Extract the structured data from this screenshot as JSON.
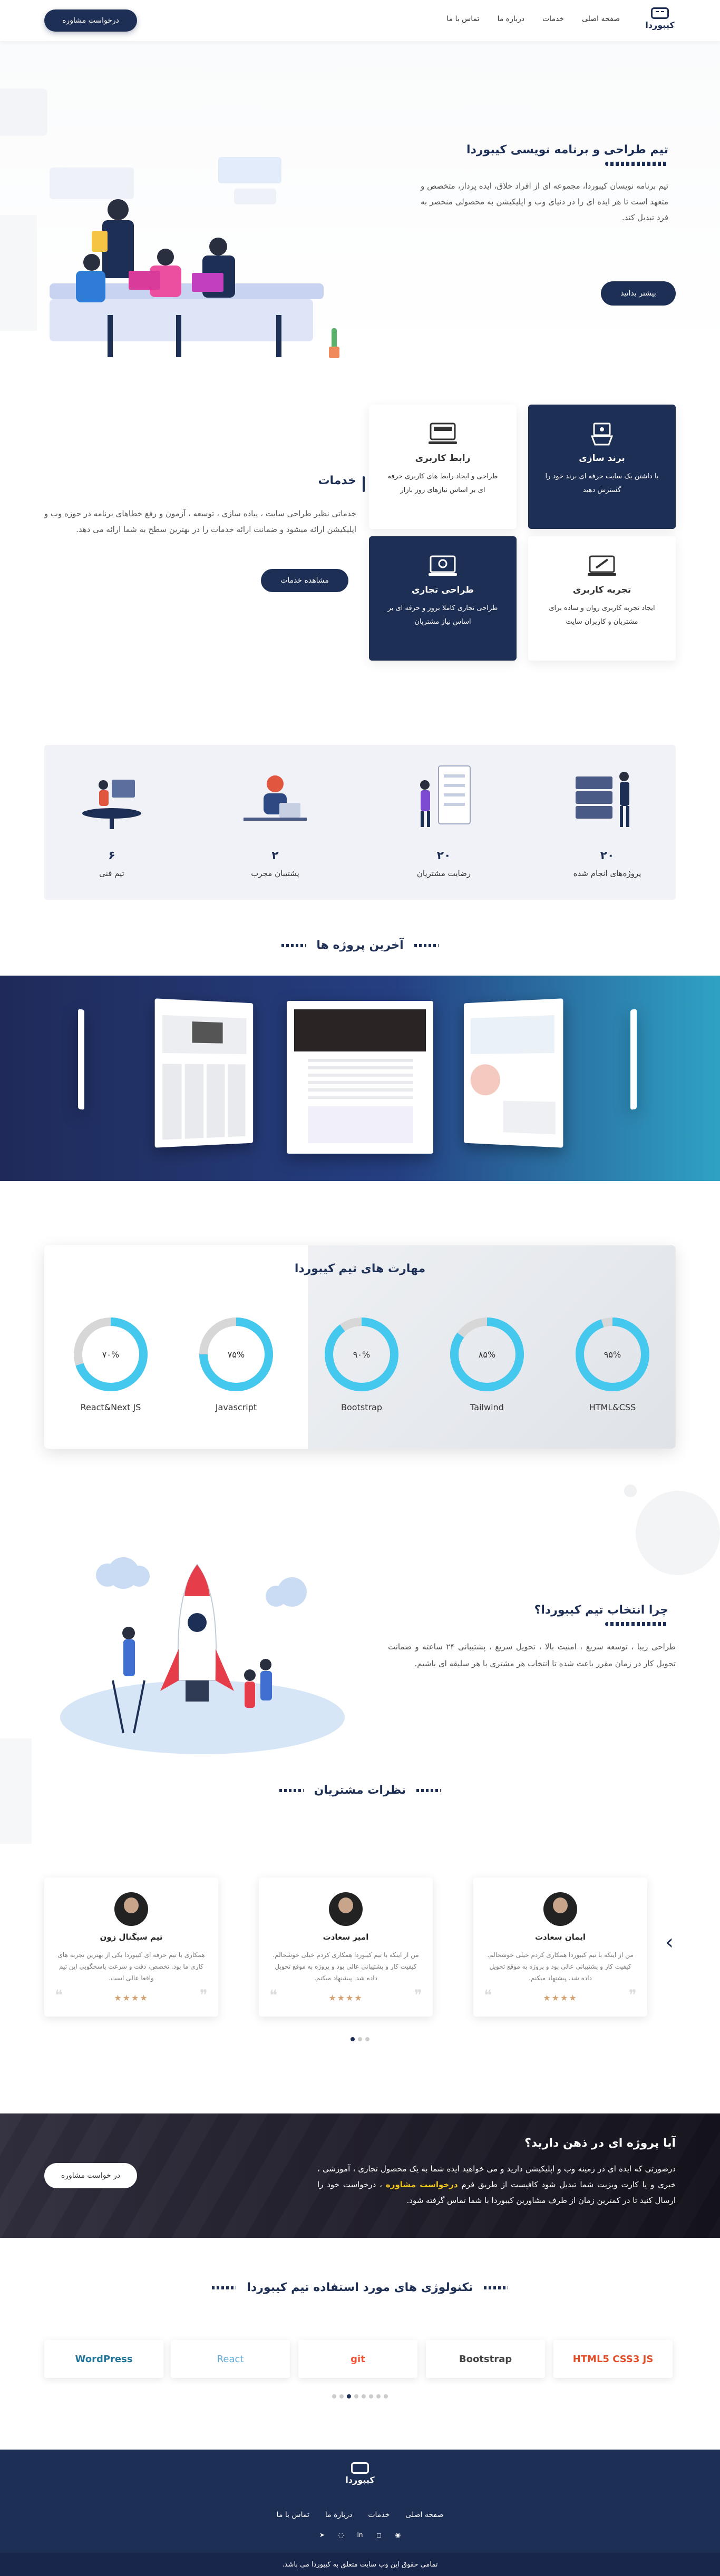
{
  "header": {
    "logo_text": "کیبوردا",
    "nav": [
      "صفحه اصلی",
      "خدمات",
      "درباره ما",
      "تماس با ما"
    ],
    "cta": "درخواست مشاوره"
  },
  "hero": {
    "title": "تیم طراحی و برنامه نویسی کیبوردا",
    "text": "تیم برنامه نویسان کیبوردا، مجموعه ای از افراد خلاق، ایده پرداز، متخصص و متعهد است تا هر ایده ای را در دنیای وب و اپلیکیشن به محصولی منحصر به فرد تبدیل کند.",
    "button": "بیشتر بدانید"
  },
  "services": {
    "title": "خدمات",
    "text": "خدماتی نظیر طراحی سایت ، پیاده سازی ، توسعه ، آزمون و رفع خطاهای برنامه در حوزه وب و اپلیکیشن ارائه میشود و ضمانت ارائه خدمات را در بهترین سطح به شما ارائه می دهد.",
    "button": "مشاهده خدمات",
    "cards": [
      {
        "title": "برند سازی",
        "text": "با داشتن یک سایت حرفه ای برند خود را گسترش دهید",
        "icon": "branding-icon"
      },
      {
        "title": "رابط کاربری",
        "text": "طراحی و ایجاد رابط های کاربری حرفه ای بر اساس نیازهای روز بازار",
        "icon": "ui-icon"
      },
      {
        "title": "تجربه کاربری",
        "text": "ایجاد تجربه کاربری روان و ساده برای مشتریان و کاربران سایت",
        "icon": "ux-icon"
      },
      {
        "title": "طراحی تجاری",
        "text": "طراحی تجاری کاملا بروز و حرفه ای بر اساس نیاز مشتریان",
        "icon": "commercial-design-icon"
      }
    ]
  },
  "stats": [
    {
      "num": "۲۰",
      "label": "پروژه‌های انجام شده"
    },
    {
      "num": "۲۰",
      "label": "رضایت مشتریان"
    },
    {
      "num": "۲",
      "label": "پشتیبان مجرب"
    },
    {
      "num": "۶",
      "label": "تیم فنی"
    }
  ],
  "projects": {
    "title": "آخرین پروژه ها"
  },
  "skills": {
    "title": "مهارت های تیم کیبوردا",
    "items": [
      {
        "label": "HTML&CSS",
        "percent": 95,
        "text": "۹۵%"
      },
      {
        "label": "Tailwind",
        "percent": 85,
        "text": "۸۵%"
      },
      {
        "label": "Bootstrap",
        "percent": 90,
        "text": "۹۰%"
      },
      {
        "label": "Javascript",
        "percent": 75,
        "text": "۷۵%"
      },
      {
        "label": "React&Next JS",
        "percent": 70,
        "text": "۷۰%"
      }
    ],
    "accent": "#45c8ee",
    "track": "#d7d7d7"
  },
  "why": {
    "title": "چرا انتخاب تیم کیبوردا؟",
    "text": "طراحی زیبا ، توسعه سریع ، امنیت بالا ، تحویل سریع ، پشتیبانی ۲۴ ساعته و ضمانت تحویل کار در زمان مقرر باعث شده تا انتخاب هر مشتری با هر سلیقه ای باشیم."
  },
  "reviews": {
    "title": "نظرات مشتریان",
    "items": [
      {
        "name": "ایمان سعادت",
        "text": "من از اینکه با تیم کیبوردا همکاری کردم خیلی خوشحالم. کیفیت کار و پشتیبانی عالی بود و پروژه به موقع تحویل داده شد. پیشنهاد میکنم.",
        "stars": "★★★★"
      },
      {
        "name": "امیر سعادت",
        "text": "من از اینکه با تیم کیبوردا همکاری کردم خیلی خوشحالم. کیفیت کار و پشتیبانی عالی بود و پروژه به موقع تحویل داده شد. پیشنهاد میکنم.",
        "stars": "★★★★"
      },
      {
        "name": "تیم سیگنال زون",
        "text": "همکاری با تیم حرفه ای کیبوردا یکی از بهترین تجربه های کاری ما بود. تخصص، دقت و سرعت پاسخگویی این تیم واقعا عالی است.",
        "stars": "★★★★"
      }
    ]
  },
  "cta_band": {
    "title": "آیا پروژه ای در ذهن دارید؟",
    "text_before": "درصورتی که ایده ای در زمینه وب و اپلیکیشن دارید و می خواهید ایده شما به یک محصول تجاری ، آموزشی ، خبری و یا کارت ویزیت شما تبدیل شود کافیست از طریق فرم ",
    "text_highlight": "درخواست مشاوره",
    "text_after": " ، درخواست خود را ارسال کنید تا در کمترین زمان از طرف مشاورین کیبوردا با شما تماس گرفته شود.",
    "button": "در خواست مشاوره"
  },
  "tech": {
    "title": "تکنولوژی های مورد استفاده تیم کیبوردا",
    "items": [
      "HTML5 CSS3 JS",
      "Bootstrap",
      "git",
      "React",
      "WordPress"
    ]
  },
  "footer": {
    "logo_text": "کیبوردا",
    "nav": [
      "صفحه اصلی",
      "خدمات",
      "درباره ما",
      "تماس با ما"
    ],
    "copyright": "تمامی حقوق این وب سایت متعلق به کیبوردا می باشد."
  },
  "colors": {
    "navy": "#1e2f55",
    "accent": "#45c8ee",
    "highlight": "#f0c419"
  }
}
